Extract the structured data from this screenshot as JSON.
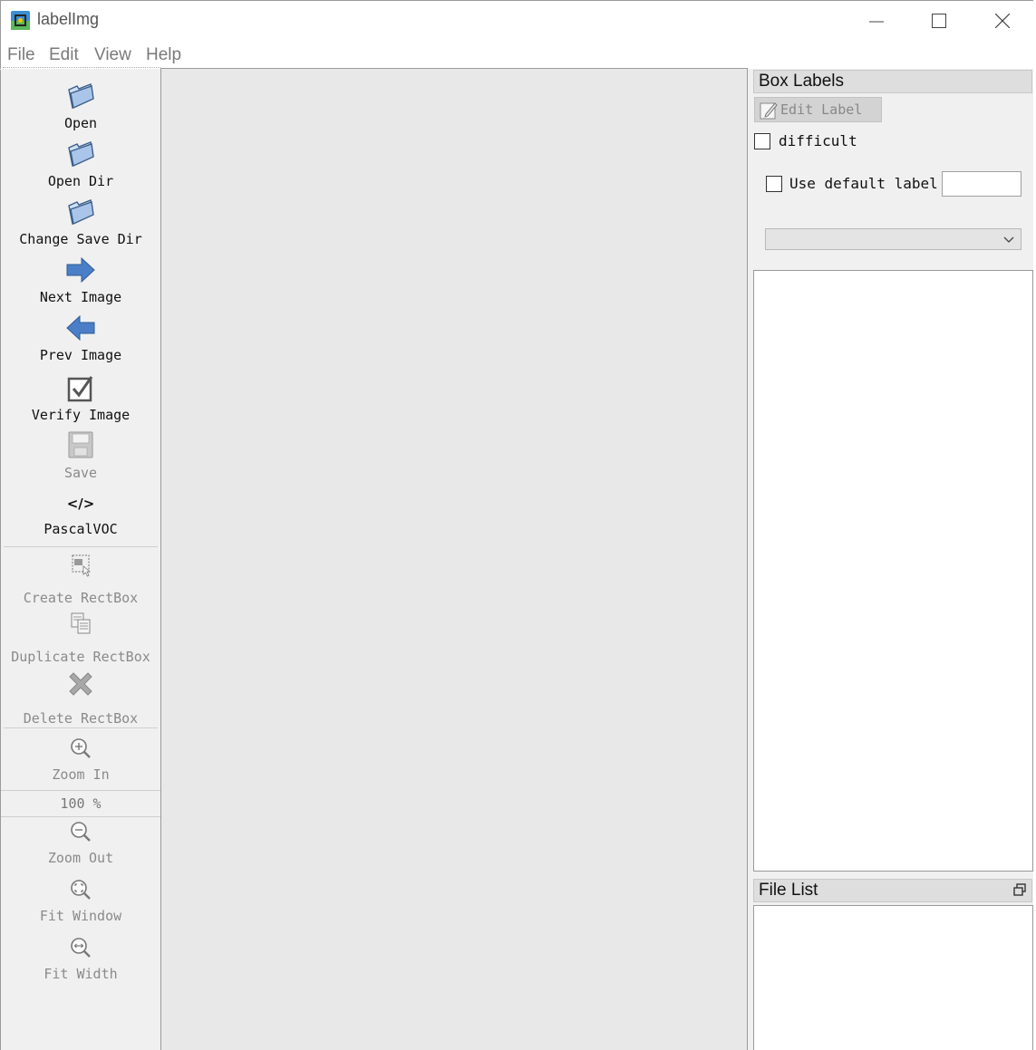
{
  "window": {
    "title": "labelImg",
    "controls": [
      "minimize",
      "maximize",
      "close"
    ]
  },
  "menu": {
    "items": [
      "File",
      "Edit",
      "View",
      "Help"
    ]
  },
  "toolbar": {
    "open": "Open",
    "open_dir": "Open Dir",
    "change_save_dir": "Change Save Dir",
    "next_image": "Next Image",
    "prev_image": "Prev Image",
    "verify_image": "Verify Image",
    "save": "Save",
    "format": "PascalVOC",
    "format_icon_text": "</>",
    "create_rectbox": "Create RectBox",
    "duplicate_rectbox": "Duplicate RectBox",
    "delete_rectbox": "Delete RectBox",
    "zoom_in": "Zoom In",
    "zoom_level": "100 %",
    "zoom_out": "Zoom Out",
    "fit_window": "Fit Window",
    "fit_width": "Fit Width"
  },
  "box_labels": {
    "title": "Box Labels",
    "edit_label": "Edit Label",
    "difficult": "difficult",
    "use_default_label": "Use default label",
    "default_label_value": ""
  },
  "file_list": {
    "title": "File List"
  },
  "colors": {
    "canvas_bg": "#e8e8e8",
    "panel_bg": "#f0f0f0",
    "arrow_blue": "#4a7fc8",
    "disabled_text": "#8a8a8a"
  }
}
